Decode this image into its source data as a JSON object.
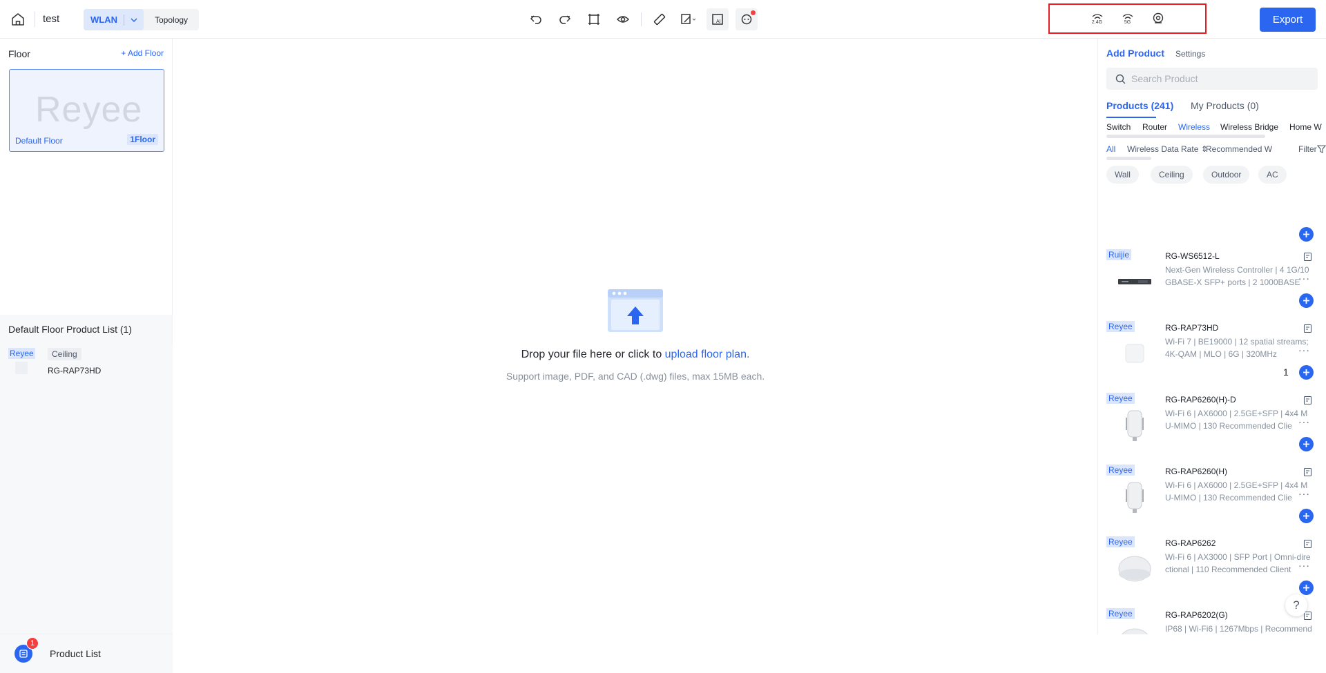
{
  "topbar": {
    "project_name": "test",
    "mode_wlan": "WLAN",
    "mode_topology": "Topology",
    "band_24_label": "2.4G",
    "band_5_label": "5G",
    "export_label": "Export"
  },
  "left": {
    "floor_title": "Floor",
    "add_floor": "+ Add Floor",
    "floor_card": {
      "logo": "Reyee",
      "name": "Default Floor",
      "tag": "1Floor"
    },
    "product_list_title": "Default Floor Product List (1)",
    "product_list_item": {
      "brand": "Reyee",
      "category": "Ceiling",
      "model": "RG-RAP73HD"
    },
    "bottom": {
      "badge": "1",
      "label": "Product List"
    }
  },
  "canvas": {
    "drop_text": "Drop your file here or click to ",
    "drop_link": "upload floor plan.",
    "support_text": "Support image, PDF, and CAD (.dwg) files, max 15MB each."
  },
  "right": {
    "tab_add": "Add Product",
    "tab_settings": "Settings",
    "search_placeholder": "Search Product",
    "tab_products": "Products (241)",
    "tab_my_products": "My Products (0)",
    "categories": [
      "Switch",
      "Router",
      "Wireless",
      "Wireless Bridge",
      "Home W"
    ],
    "active_category": "Wireless",
    "subfilters": {
      "all": "All",
      "rate": "Wireless Data Rate",
      "recommended": "Recommended W",
      "filter": "Filter"
    },
    "chips": [
      "Wall",
      "Ceiling",
      "Outdoor",
      "AC"
    ],
    "products": [
      {
        "brand": "Ruijie",
        "model": "RG-WS6512-L",
        "desc1": "Next-Gen Wireless Controller | 4 1G/10",
        "desc2": "GBASE-X SFP+ ports | 2 1000BASE",
        "qty": ""
      },
      {
        "brand": "Reyee",
        "model": "RG-RAP73HD",
        "desc1": "Wi-Fi 7 | BE19000 | 12 spatial streams;",
        "desc2": "4K-QAM | MLO | 6G | 320MHz",
        "qty": "1"
      },
      {
        "brand": "Reyee",
        "model": "RG-RAP6260(H)-D",
        "desc1": "Wi-Fi 6 | AX6000 | 2.5GE+SFP | 4x4 M",
        "desc2": "U-MIMO | 130 Recommended Clie",
        "qty": ""
      },
      {
        "brand": "Reyee",
        "model": "RG-RAP6260(H)",
        "desc1": "Wi-Fi 6 | AX6000 | 2.5GE+SFP | 4x4 M",
        "desc2": "U-MIMO | 130 Recommended Clie",
        "qty": ""
      },
      {
        "brand": "Reyee",
        "model": "RG-RAP6262",
        "desc1": "Wi-Fi 6 | AX3000 | SFP Port | Omni-dire",
        "desc2": "ctional | 110 Recommended Client",
        "qty": ""
      },
      {
        "brand": "Reyee",
        "model": "RG-RAP6202(G)",
        "desc1": "IP68 | Wi-Fi6 | 1267Mbps | Recommend",
        "desc2": "",
        "qty": ""
      }
    ],
    "help": "?"
  },
  "colors": {
    "accent": "#2a66f0",
    "badge": "#f53f3f",
    "highlight_box": "#e51c23"
  }
}
